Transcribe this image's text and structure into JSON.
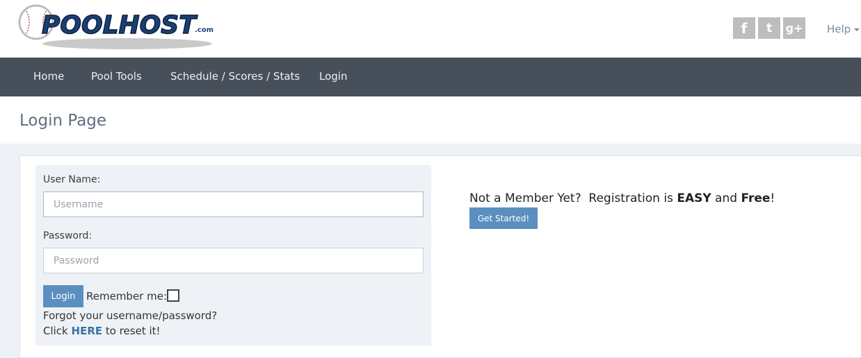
{
  "header": {
    "logo_main": "POOLHOST",
    "logo_suffix": ".com",
    "social": [
      {
        "name": "facebook",
        "glyph": "f"
      },
      {
        "name": "twitter",
        "glyph": "t"
      },
      {
        "name": "google-plus",
        "glyph": "g+"
      }
    ],
    "help_label": "Help"
  },
  "nav": {
    "items": [
      "Home",
      "Pool Tools",
      "Schedule / Scores / Stats",
      "Login"
    ]
  },
  "page": {
    "title": "Login Page"
  },
  "login": {
    "username_label": "User Name:",
    "username_placeholder": "Username",
    "username_value": "",
    "password_label": "Password:",
    "password_placeholder": "Password",
    "password_value": "",
    "login_button": "Login",
    "remember_label": "Remember me:",
    "remember_checked": false,
    "forgot_line1": "Forgot your username/password?",
    "forgot_click": "Click ",
    "forgot_here": "HERE",
    "forgot_tail": " to reset it!"
  },
  "register": {
    "prefix": "Not a Member Yet?  Registration is ",
    "easy": "EASY",
    "and": " and ",
    "free": "Free",
    "suffix": "!",
    "button": "Get Started!"
  },
  "colors": {
    "nav_bg": "#474f5a",
    "accent_button": "#5b8fbf",
    "panel_bg": "#eef2f6",
    "link": "#3b6fa3"
  }
}
